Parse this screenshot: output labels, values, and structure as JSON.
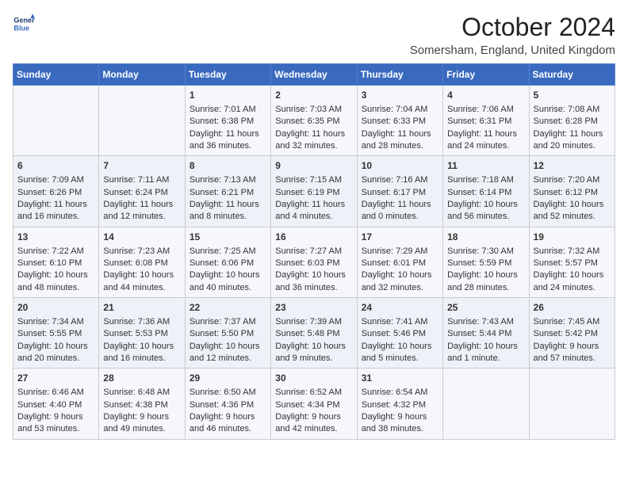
{
  "header": {
    "logo_line1": "General",
    "logo_line2": "Blue",
    "month": "October 2024",
    "location": "Somersham, England, United Kingdom"
  },
  "days_of_week": [
    "Sunday",
    "Monday",
    "Tuesday",
    "Wednesday",
    "Thursday",
    "Friday",
    "Saturday"
  ],
  "weeks": [
    [
      {
        "day": "",
        "sunrise": "",
        "sunset": "",
        "daylight": ""
      },
      {
        "day": "",
        "sunrise": "",
        "sunset": "",
        "daylight": ""
      },
      {
        "day": "1",
        "sunrise": "Sunrise: 7:01 AM",
        "sunset": "Sunset: 6:38 PM",
        "daylight": "Daylight: 11 hours and 36 minutes."
      },
      {
        "day": "2",
        "sunrise": "Sunrise: 7:03 AM",
        "sunset": "Sunset: 6:35 PM",
        "daylight": "Daylight: 11 hours and 32 minutes."
      },
      {
        "day": "3",
        "sunrise": "Sunrise: 7:04 AM",
        "sunset": "Sunset: 6:33 PM",
        "daylight": "Daylight: 11 hours and 28 minutes."
      },
      {
        "day": "4",
        "sunrise": "Sunrise: 7:06 AM",
        "sunset": "Sunset: 6:31 PM",
        "daylight": "Daylight: 11 hours and 24 minutes."
      },
      {
        "day": "5",
        "sunrise": "Sunrise: 7:08 AM",
        "sunset": "Sunset: 6:28 PM",
        "daylight": "Daylight: 11 hours and 20 minutes."
      }
    ],
    [
      {
        "day": "6",
        "sunrise": "Sunrise: 7:09 AM",
        "sunset": "Sunset: 6:26 PM",
        "daylight": "Daylight: 11 hours and 16 minutes."
      },
      {
        "day": "7",
        "sunrise": "Sunrise: 7:11 AM",
        "sunset": "Sunset: 6:24 PM",
        "daylight": "Daylight: 11 hours and 12 minutes."
      },
      {
        "day": "8",
        "sunrise": "Sunrise: 7:13 AM",
        "sunset": "Sunset: 6:21 PM",
        "daylight": "Daylight: 11 hours and 8 minutes."
      },
      {
        "day": "9",
        "sunrise": "Sunrise: 7:15 AM",
        "sunset": "Sunset: 6:19 PM",
        "daylight": "Daylight: 11 hours and 4 minutes."
      },
      {
        "day": "10",
        "sunrise": "Sunrise: 7:16 AM",
        "sunset": "Sunset: 6:17 PM",
        "daylight": "Daylight: 11 hours and 0 minutes."
      },
      {
        "day": "11",
        "sunrise": "Sunrise: 7:18 AM",
        "sunset": "Sunset: 6:14 PM",
        "daylight": "Daylight: 10 hours and 56 minutes."
      },
      {
        "day": "12",
        "sunrise": "Sunrise: 7:20 AM",
        "sunset": "Sunset: 6:12 PM",
        "daylight": "Daylight: 10 hours and 52 minutes."
      }
    ],
    [
      {
        "day": "13",
        "sunrise": "Sunrise: 7:22 AM",
        "sunset": "Sunset: 6:10 PM",
        "daylight": "Daylight: 10 hours and 48 minutes."
      },
      {
        "day": "14",
        "sunrise": "Sunrise: 7:23 AM",
        "sunset": "Sunset: 6:08 PM",
        "daylight": "Daylight: 10 hours and 44 minutes."
      },
      {
        "day": "15",
        "sunrise": "Sunrise: 7:25 AM",
        "sunset": "Sunset: 6:06 PM",
        "daylight": "Daylight: 10 hours and 40 minutes."
      },
      {
        "day": "16",
        "sunrise": "Sunrise: 7:27 AM",
        "sunset": "Sunset: 6:03 PM",
        "daylight": "Daylight: 10 hours and 36 minutes."
      },
      {
        "day": "17",
        "sunrise": "Sunrise: 7:29 AM",
        "sunset": "Sunset: 6:01 PM",
        "daylight": "Daylight: 10 hours and 32 minutes."
      },
      {
        "day": "18",
        "sunrise": "Sunrise: 7:30 AM",
        "sunset": "Sunset: 5:59 PM",
        "daylight": "Daylight: 10 hours and 28 minutes."
      },
      {
        "day": "19",
        "sunrise": "Sunrise: 7:32 AM",
        "sunset": "Sunset: 5:57 PM",
        "daylight": "Daylight: 10 hours and 24 minutes."
      }
    ],
    [
      {
        "day": "20",
        "sunrise": "Sunrise: 7:34 AM",
        "sunset": "Sunset: 5:55 PM",
        "daylight": "Daylight: 10 hours and 20 minutes."
      },
      {
        "day": "21",
        "sunrise": "Sunrise: 7:36 AM",
        "sunset": "Sunset: 5:53 PM",
        "daylight": "Daylight: 10 hours and 16 minutes."
      },
      {
        "day": "22",
        "sunrise": "Sunrise: 7:37 AM",
        "sunset": "Sunset: 5:50 PM",
        "daylight": "Daylight: 10 hours and 12 minutes."
      },
      {
        "day": "23",
        "sunrise": "Sunrise: 7:39 AM",
        "sunset": "Sunset: 5:48 PM",
        "daylight": "Daylight: 10 hours and 9 minutes."
      },
      {
        "day": "24",
        "sunrise": "Sunrise: 7:41 AM",
        "sunset": "Sunset: 5:46 PM",
        "daylight": "Daylight: 10 hours and 5 minutes."
      },
      {
        "day": "25",
        "sunrise": "Sunrise: 7:43 AM",
        "sunset": "Sunset: 5:44 PM",
        "daylight": "Daylight: 10 hours and 1 minute."
      },
      {
        "day": "26",
        "sunrise": "Sunrise: 7:45 AM",
        "sunset": "Sunset: 5:42 PM",
        "daylight": "Daylight: 9 hours and 57 minutes."
      }
    ],
    [
      {
        "day": "27",
        "sunrise": "Sunrise: 6:46 AM",
        "sunset": "Sunset: 4:40 PM",
        "daylight": "Daylight: 9 hours and 53 minutes."
      },
      {
        "day": "28",
        "sunrise": "Sunrise: 6:48 AM",
        "sunset": "Sunset: 4:38 PM",
        "daylight": "Daylight: 9 hours and 49 minutes."
      },
      {
        "day": "29",
        "sunrise": "Sunrise: 6:50 AM",
        "sunset": "Sunset: 4:36 PM",
        "daylight": "Daylight: 9 hours and 46 minutes."
      },
      {
        "day": "30",
        "sunrise": "Sunrise: 6:52 AM",
        "sunset": "Sunset: 4:34 PM",
        "daylight": "Daylight: 9 hours and 42 minutes."
      },
      {
        "day": "31",
        "sunrise": "Sunrise: 6:54 AM",
        "sunset": "Sunset: 4:32 PM",
        "daylight": "Daylight: 9 hours and 38 minutes."
      },
      {
        "day": "",
        "sunrise": "",
        "sunset": "",
        "daylight": ""
      },
      {
        "day": "",
        "sunrise": "",
        "sunset": "",
        "daylight": ""
      }
    ]
  ]
}
